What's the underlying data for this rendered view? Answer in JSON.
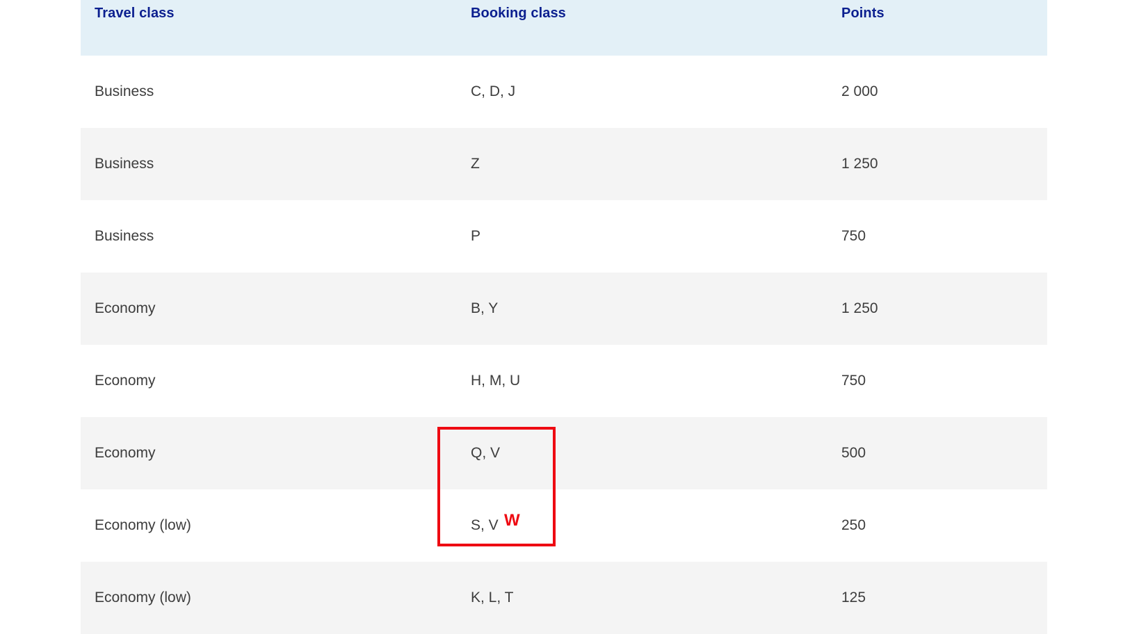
{
  "table": {
    "headers": {
      "travel_class": "Travel class",
      "booking_class": "Booking class",
      "points": "Points"
    },
    "rows": [
      {
        "travel_class": "Business",
        "booking_class": "C, D, J",
        "points": "2 000"
      },
      {
        "travel_class": "Business",
        "booking_class": "Z",
        "points": "1 250"
      },
      {
        "travel_class": "Business",
        "booking_class": "P",
        "points": "750"
      },
      {
        "travel_class": "Economy",
        "booking_class": "B, Y",
        "points": "1 250"
      },
      {
        "travel_class": "Economy",
        "booking_class": "H, M, U",
        "points": "750"
      },
      {
        "travel_class": "Economy",
        "booking_class": "Q, V",
        "points": "500"
      },
      {
        "travel_class": "Economy (low)",
        "booking_class": "S, V",
        "points": "250"
      },
      {
        "travel_class": "Economy (low)",
        "booking_class": "K, L, T",
        "points": "125"
      }
    ]
  },
  "annotation": {
    "mark": "W",
    "color": "#ee0a12"
  },
  "colors": {
    "header_bg": "#e3f0f7",
    "header_text": "#0b1f8f",
    "row_alt_bg": "#f4f4f4",
    "body_text": "#3d3d3d"
  }
}
